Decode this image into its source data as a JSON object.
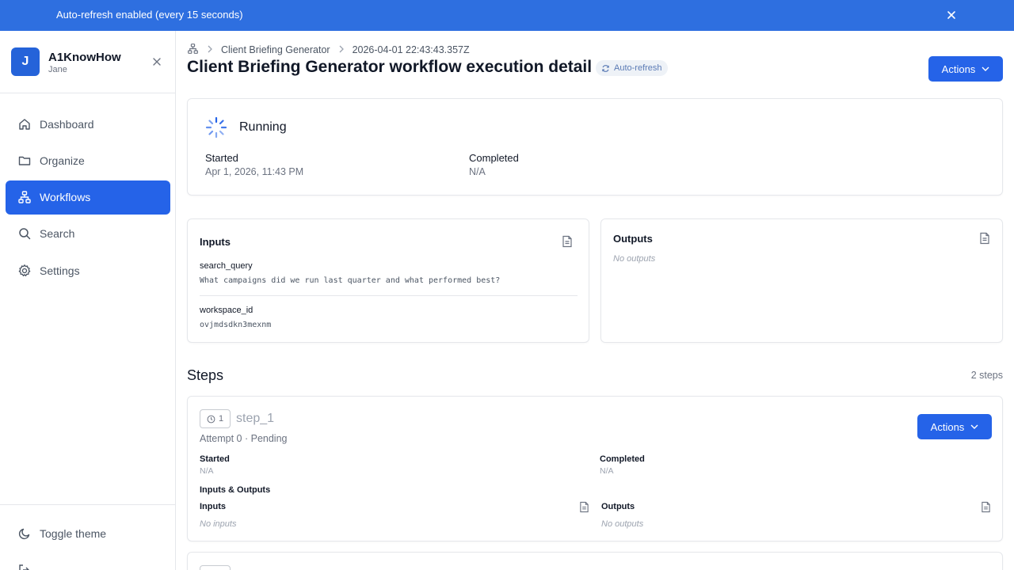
{
  "banner": {
    "text": "Auto-refresh enabled (every 15 seconds)"
  },
  "sidebar": {
    "avatar_initial": "J",
    "app_name": "A1KnowHow",
    "user_name": "Jane",
    "items": [
      {
        "label": "Dashboard",
        "icon": "home-icon"
      },
      {
        "label": "Organize",
        "icon": "folder-icon"
      },
      {
        "label": "Workflows",
        "icon": "workflow-icon",
        "active": true
      },
      {
        "label": "Search",
        "icon": "search-icon"
      },
      {
        "label": "Settings",
        "icon": "gear-icon"
      }
    ],
    "footer": {
      "toggle_theme": "Toggle theme"
    }
  },
  "breadcrumb": {
    "item1": "Client Briefing Generator",
    "item2": "2026-04-01 22:43:43.357Z"
  },
  "header": {
    "title": "Client Briefing Generator workflow execution detail",
    "badge": "Auto-refresh",
    "actions": "Actions"
  },
  "status": {
    "label": "Running",
    "started_label": "Started",
    "started_value": "Apr 1, 2026, 11:43 PM",
    "completed_label": "Completed",
    "completed_value": "N/A"
  },
  "inputs": {
    "title": "Inputs",
    "fields": [
      {
        "key": "search_query",
        "value": "What campaigns did we run last quarter and what performed best?"
      },
      {
        "key": "workspace_id",
        "value": "ovjmdsdkn3mexnm"
      }
    ]
  },
  "outputs": {
    "title": "Outputs",
    "empty": "No outputs"
  },
  "steps": {
    "title": "Steps",
    "count": "2 steps",
    "items": [
      {
        "number": "1",
        "name": "step_1",
        "attempt": "Attempt 0 · Pending",
        "actions": "Actions",
        "started_label": "Started",
        "started_value": "N/A",
        "completed_label": "Completed",
        "completed_value": "N/A",
        "io_label": "Inputs & Outputs",
        "inputs_label": "Inputs",
        "inputs_empty": "No inputs",
        "outputs_label": "Outputs",
        "outputs_empty": "No outputs"
      }
    ]
  },
  "colors": {
    "primary": "#2563e8",
    "banner": "#2e6fe0"
  }
}
